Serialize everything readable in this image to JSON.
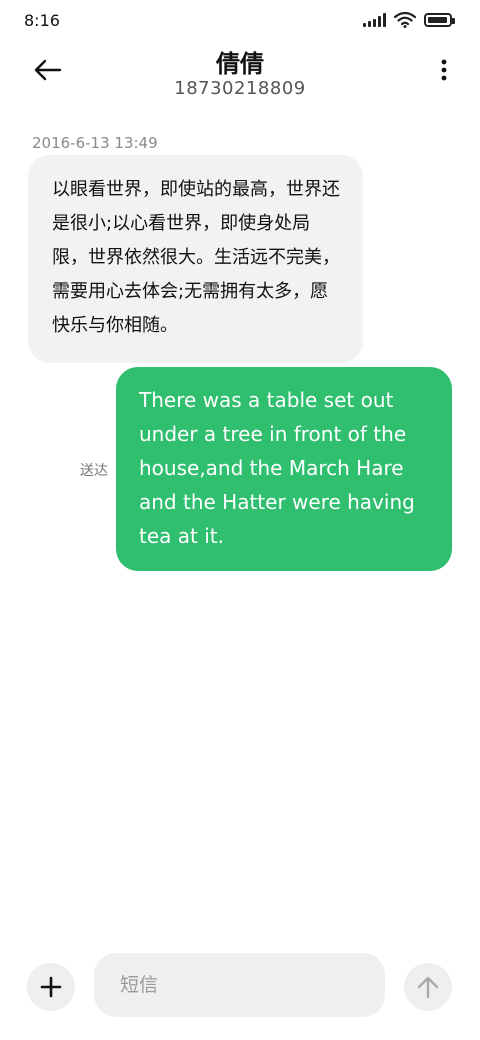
{
  "status_bar": {
    "time": "8:16",
    "icons": [
      "signal-icon",
      "wifi-icon",
      "battery-icon"
    ],
    "battery_level": 0.8
  },
  "header": {
    "title": "倩倩",
    "subtitle": "18730218809",
    "icons": [
      "back-arrow-icon",
      "more-vertical-icon"
    ]
  },
  "conversation": {
    "timestamp": "2016-6-13 13:49",
    "incoming": {
      "text": "以眼看世界，即使站的最高，世界还是很小;以心看世界，即使身处局限，世界依然很大。生活远不完美，需要用心去体会;无需拥有太多，愿快乐与你相随。",
      "background": "#f2f2f2"
    },
    "outgoing": {
      "text": "There was a table set out under a tree in front of the house,and the March Hare and the Hatter were having tea at it.",
      "status": "送达",
      "background": "#2fbf6f"
    }
  },
  "input_bar": {
    "placeholder": "短信",
    "value": "",
    "icons": [
      "plus-icon",
      "send-arrow-up-icon"
    ]
  }
}
